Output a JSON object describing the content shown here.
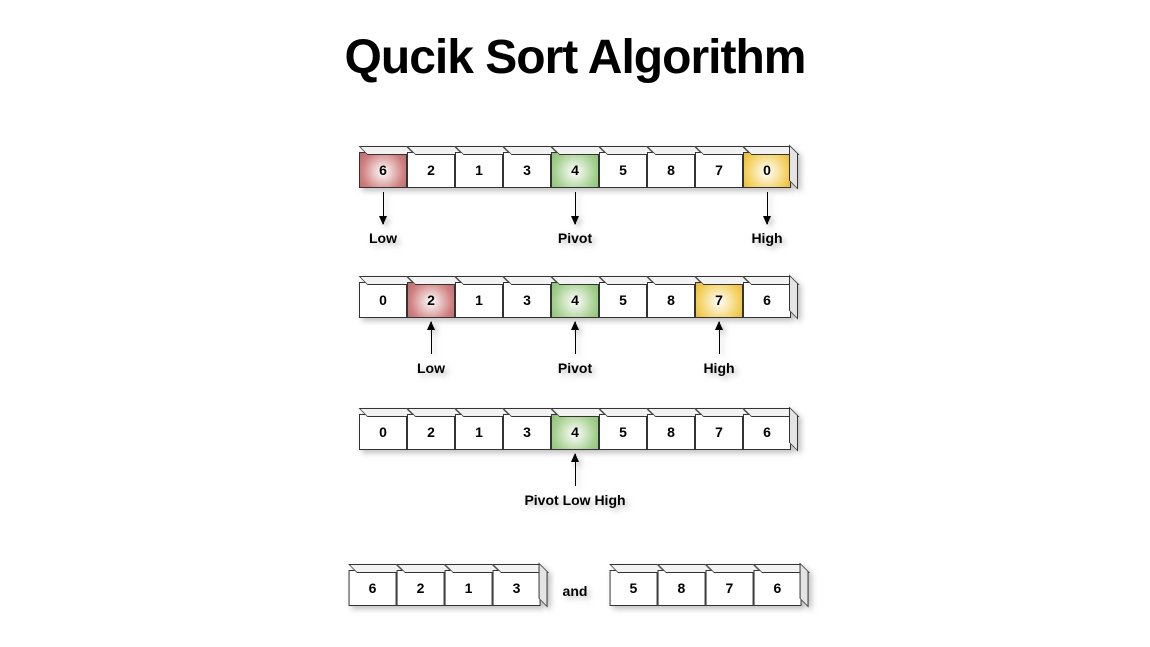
{
  "title": "Qucik Sort Algorithm",
  "labels": {
    "low": "Low",
    "pivot": "Pivot",
    "high": "High",
    "pivot_low_high": "Pivot Low High",
    "and": "and"
  },
  "rows": [
    {
      "cells": [
        {
          "v": "6",
          "color": "red"
        },
        {
          "v": "2",
          "color": ""
        },
        {
          "v": "1",
          "color": ""
        },
        {
          "v": "3",
          "color": ""
        },
        {
          "v": "4",
          "color": "green"
        },
        {
          "v": "5",
          "color": ""
        },
        {
          "v": "8",
          "color": ""
        },
        {
          "v": "7",
          "color": ""
        },
        {
          "v": "0",
          "color": "yellow"
        }
      ],
      "arrows": [
        {
          "idx": 0,
          "dir": "down",
          "label_key": "low"
        },
        {
          "idx": 4,
          "dir": "down",
          "label_key": "pivot"
        },
        {
          "idx": 8,
          "dir": "down",
          "label_key": "high"
        }
      ]
    },
    {
      "cells": [
        {
          "v": "0",
          "color": ""
        },
        {
          "v": "2",
          "color": "red"
        },
        {
          "v": "1",
          "color": ""
        },
        {
          "v": "3",
          "color": ""
        },
        {
          "v": "4",
          "color": "green"
        },
        {
          "v": "5",
          "color": ""
        },
        {
          "v": "8",
          "color": ""
        },
        {
          "v": "7",
          "color": "yellow"
        },
        {
          "v": "6",
          "color": ""
        }
      ],
      "arrows": [
        {
          "idx": 1,
          "dir": "up",
          "label_key": "low"
        },
        {
          "idx": 4,
          "dir": "up",
          "label_key": "pivot"
        },
        {
          "idx": 7,
          "dir": "up",
          "label_key": "high"
        }
      ]
    },
    {
      "cells": [
        {
          "v": "0",
          "color": ""
        },
        {
          "v": "2",
          "color": ""
        },
        {
          "v": "1",
          "color": ""
        },
        {
          "v": "3",
          "color": ""
        },
        {
          "v": "4",
          "color": "green"
        },
        {
          "v": "5",
          "color": ""
        },
        {
          "v": "8",
          "color": ""
        },
        {
          "v": "7",
          "color": ""
        },
        {
          "v": "6",
          "color": ""
        }
      ],
      "arrows": [
        {
          "idx": 4,
          "dir": "up",
          "label_key": "pivot_low_high"
        }
      ]
    }
  ],
  "split": {
    "left": [
      "6",
      "2",
      "1",
      "3"
    ],
    "right": [
      "5",
      "8",
      "7",
      "6"
    ]
  },
  "chart_data": {
    "type": "table",
    "title": "Qucik Sort Algorithm",
    "description": "Quick sort partition steps with Low, Pivot, High pointers",
    "steps": [
      {
        "array": [
          6,
          2,
          1,
          3,
          4,
          5,
          8,
          7,
          0
        ],
        "low": 0,
        "pivot": 4,
        "high": 8,
        "arrow_dir": "down"
      },
      {
        "array": [
          0,
          2,
          1,
          3,
          4,
          5,
          8,
          7,
          6
        ],
        "low": 1,
        "pivot": 4,
        "high": 7,
        "arrow_dir": "up"
      },
      {
        "array": [
          0,
          2,
          1,
          3,
          4,
          5,
          8,
          7,
          6
        ],
        "low": 4,
        "pivot": 4,
        "high": 4,
        "arrow_dir": "up"
      }
    ],
    "final_partitions": {
      "left": [
        6,
        2,
        1,
        3
      ],
      "right": [
        5,
        8,
        7,
        6
      ]
    }
  }
}
